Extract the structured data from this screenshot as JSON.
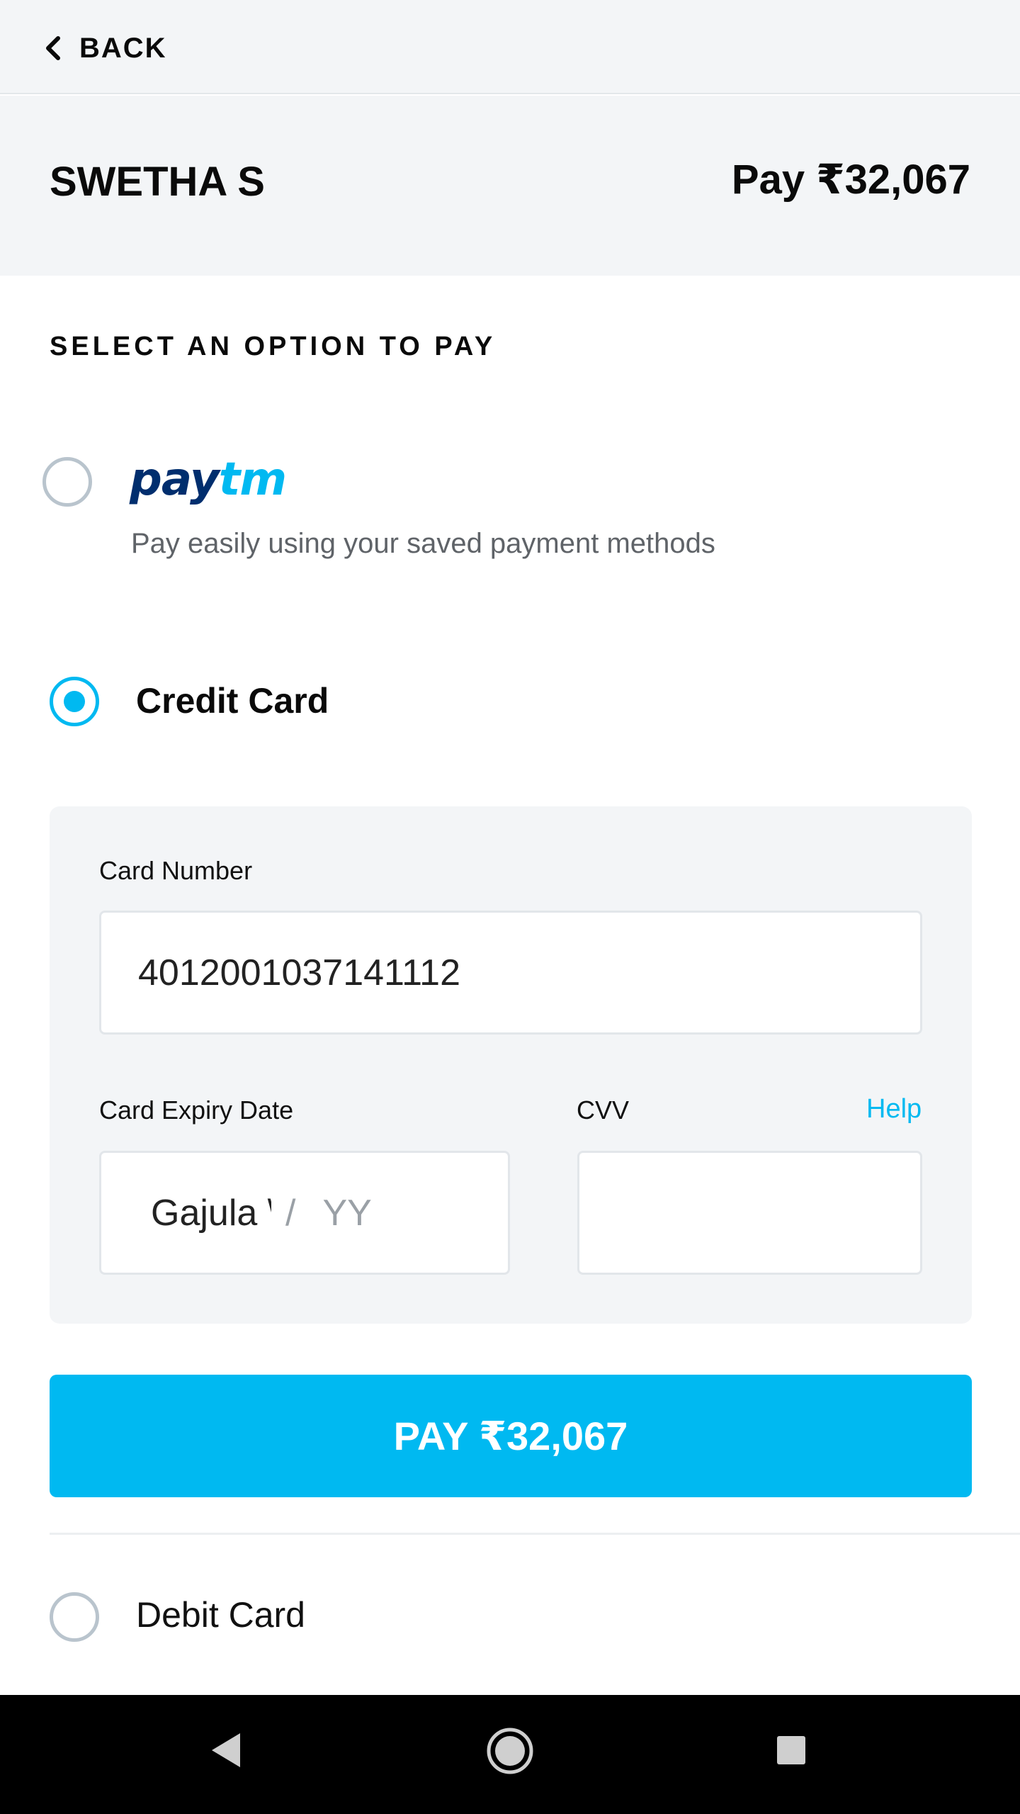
{
  "topbar": {
    "back_label": "BACK",
    "back_icon": "chevron-left-icon"
  },
  "header": {
    "merchant_name": "SWETHA S",
    "amount_label": "Pay ₹32,067"
  },
  "section": {
    "title": "SELECT AN OPTION TO PAY"
  },
  "options": {
    "paytm": {
      "logo_pay": "pay",
      "logo_tm": "tm",
      "description": "Pay easily using your saved payment methods",
      "selected": false
    },
    "credit_card": {
      "label": "Credit Card",
      "selected": true
    },
    "debit_card": {
      "label": "Debit Card",
      "selected": false
    }
  },
  "card_form": {
    "card_number_label": "Card Number",
    "card_number_value": "4012001037141112",
    "expiry_label": "Card Expiry Date",
    "expiry_month_value": "Gajula \\",
    "expiry_separator": "/",
    "expiry_year_placeholder": "YY",
    "cvv_label": "CVV",
    "cvv_value": "",
    "help_label": "Help"
  },
  "pay_button": {
    "label": "PAY ₹32,067"
  },
  "navbar": {
    "back_icon": "triangle-back-icon",
    "home_icon": "circle-home-icon",
    "recents_icon": "square-recents-icon"
  },
  "colors": {
    "accent": "#00b9f1",
    "paytm_navy": "#002e6e",
    "panel_bg": "#f3f5f7",
    "radio_border": "#b9c4cd"
  }
}
